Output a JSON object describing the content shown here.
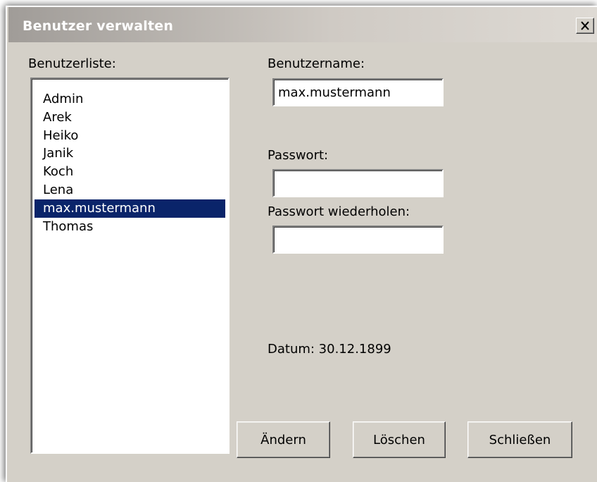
{
  "window": {
    "title": "Benutzer verwalten"
  },
  "userlist": {
    "label": "Benutzerliste:",
    "items": [
      "Admin",
      "Arek",
      "Heiko",
      "Janik",
      "Koch",
      "Lena",
      "max.mustermann",
      "Thomas"
    ],
    "selected": "max.mustermann"
  },
  "form": {
    "username_label": "Benutzername:",
    "username_value": "max.mustermann",
    "password_label": "Passwort:",
    "password_value": "",
    "password_repeat_label": "Passwort wiederholen:",
    "password_repeat_value": "",
    "date_text": "Datum: 30.12.1899"
  },
  "buttons": {
    "change": "Ändern",
    "delete": "Löschen",
    "close": "Schließen"
  },
  "colors": {
    "selection": "#0a246a",
    "dialog_bg": "#d4d0c8"
  }
}
